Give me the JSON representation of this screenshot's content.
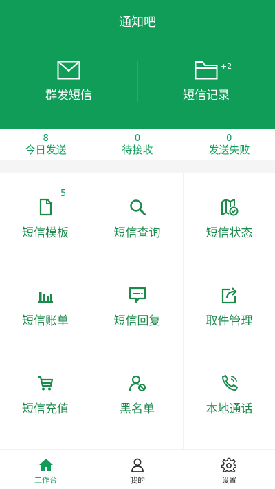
{
  "header": {
    "title": "通知吧",
    "actions": [
      {
        "label": "群发短信",
        "icon": "envelope-icon"
      },
      {
        "label": "短信记录",
        "icon": "folder-icon",
        "badge": "+2"
      }
    ]
  },
  "stats": [
    {
      "value": "8",
      "label": "今日发送"
    },
    {
      "value": "0",
      "label": "待接收"
    },
    {
      "value": "0",
      "label": "发送失败"
    }
  ],
  "grid": [
    {
      "label": "短信模板",
      "icon": "document-icon",
      "badge": "5"
    },
    {
      "label": "短信查询",
      "icon": "search-icon"
    },
    {
      "label": "短信状态",
      "icon": "map-status-icon"
    },
    {
      "label": "短信账单",
      "icon": "bar-chart-icon"
    },
    {
      "label": "短信回复",
      "icon": "message-reply-icon"
    },
    {
      "label": "取件管理",
      "icon": "share-icon"
    },
    {
      "label": "短信充值",
      "icon": "cart-icon"
    },
    {
      "label": "黑名单",
      "icon": "user-block-icon"
    },
    {
      "label": "本地通话",
      "icon": "phone-icon"
    }
  ],
  "tabs": [
    {
      "label": "工作台",
      "icon": "home-icon",
      "active": true
    },
    {
      "label": "我的",
      "icon": "user-icon"
    },
    {
      "label": "设置",
      "icon": "gear-icon"
    }
  ],
  "colors": {
    "primary": "#0f9d58",
    "icon": "#1b8a4b",
    "background": "#f5f5f5"
  }
}
